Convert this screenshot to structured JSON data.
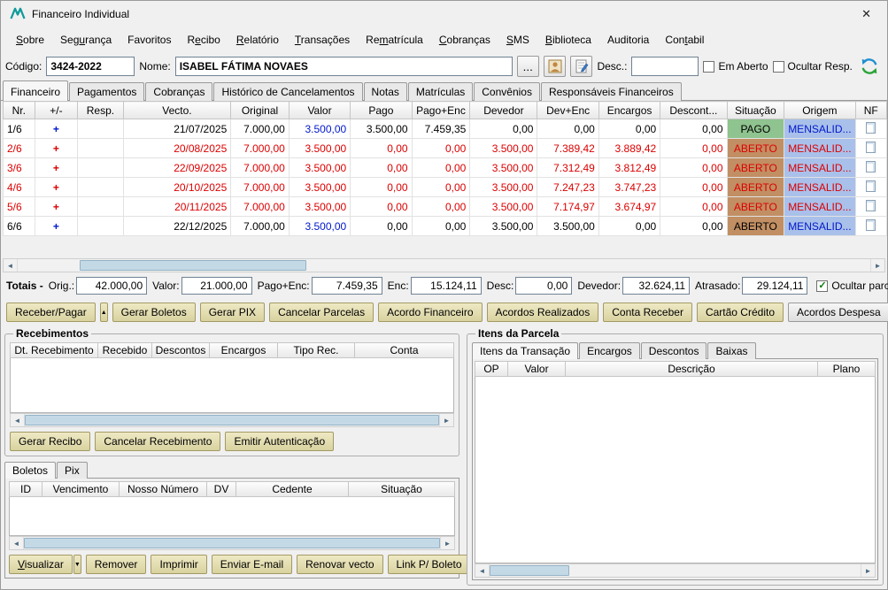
{
  "window": {
    "title": "Financeiro Individual"
  },
  "icons": {
    "close": "✕",
    "check": "✓",
    "up_arrow": "▲",
    "down_arrow": "▼",
    "scroll_left": "◄",
    "scroll_right": "►"
  },
  "colors": {
    "pago_bg": "#8fc38f",
    "aberto_bg": "#c18f63",
    "origem_bg": "#a9c0ea",
    "late_text": "#dc0000",
    "value_text": "#0018cc",
    "button_bg": "#d8d2a0"
  },
  "menu": {
    "items": [
      {
        "label": "Sobre",
        "u": 0
      },
      {
        "label": "Segurança",
        "u": 3
      },
      {
        "label": "Favoritos",
        "u": -1
      },
      {
        "label": "Recibo",
        "u": 1
      },
      {
        "label": "Relatório",
        "u": 0
      },
      {
        "label": "Transações",
        "u": 0
      },
      {
        "label": "Rematrícula",
        "u": 2
      },
      {
        "label": "Cobranças",
        "u": 0
      },
      {
        "label": "SMS",
        "u": 0
      },
      {
        "label": "Biblioteca",
        "u": 0
      },
      {
        "label": "Auditoria",
        "u": -1
      },
      {
        "label": "Contabil",
        "u": 3
      }
    ]
  },
  "header": {
    "codigo_label": "Código:",
    "codigo_value": "3424-2022",
    "nome_label": "Nome:",
    "nome_value": "ISABEL FÁTIMA NOVAES",
    "browse_label": "...",
    "desc_label": "Desc.:",
    "desc_value": "",
    "em_aberto": "Em Aberto",
    "ocultar_resp": "Ocultar Resp."
  },
  "tabs": [
    "Financeiro",
    "Pagamentos",
    "Cobranças",
    "Histórico de Cancelamentos",
    "Notas",
    "Matrículas",
    "Convênios",
    "Responsáveis Financeiros"
  ],
  "grid": {
    "columns": [
      "Nr.",
      "+/-",
      "Resp.",
      "Vecto.",
      "Original",
      "Valor",
      "Pago",
      "Pago+Enc",
      "Devedor",
      "Dev+Enc",
      "Encargos",
      "Descont...",
      "Situação",
      "Origem",
      "NF"
    ],
    "rows": [
      {
        "nr": "1/6",
        "plus": "+",
        "resp": "",
        "vecto": "21/07/2025",
        "original": "7.000,00",
        "valor": "3.500,00",
        "pago": "3.500,00",
        "pago_enc": "7.459,35",
        "devedor": "0,00",
        "dev_enc": "0,00",
        "encargos": "0,00",
        "descont": "0,00",
        "situacao": "PAGO",
        "origem": "MENSALID...",
        "state": "paid"
      },
      {
        "nr": "2/6",
        "plus": "+",
        "resp": "",
        "vecto": "20/08/2025",
        "original": "7.000,00",
        "valor": "3.500,00",
        "pago": "0,00",
        "pago_enc": "0,00",
        "devedor": "3.500,00",
        "dev_enc": "7.389,42",
        "encargos": "3.889,42",
        "descont": "0,00",
        "situacao": "ABERTO",
        "origem": "MENSALID...",
        "state": "late"
      },
      {
        "nr": "3/6",
        "plus": "+",
        "resp": "",
        "vecto": "22/09/2025",
        "original": "7.000,00",
        "valor": "3.500,00",
        "pago": "0,00",
        "pago_enc": "0,00",
        "devedor": "3.500,00",
        "dev_enc": "7.312,49",
        "encargos": "3.812,49",
        "descont": "0,00",
        "situacao": "ABERTO",
        "origem": "MENSALID...",
        "state": "late"
      },
      {
        "nr": "4/6",
        "plus": "+",
        "resp": "",
        "vecto": "20/10/2025",
        "original": "7.000,00",
        "valor": "3.500,00",
        "pago": "0,00",
        "pago_enc": "0,00",
        "devedor": "3.500,00",
        "dev_enc": "7.247,23",
        "encargos": "3.747,23",
        "descont": "0,00",
        "situacao": "ABERTO",
        "origem": "MENSALID...",
        "state": "late"
      },
      {
        "nr": "5/6",
        "plus": "+",
        "resp": "",
        "vecto": "20/11/2025",
        "original": "7.000,00",
        "valor": "3.500,00",
        "pago": "0,00",
        "pago_enc": "0,00",
        "devedor": "3.500,00",
        "dev_enc": "7.174,97",
        "encargos": "3.674,97",
        "descont": "0,00",
        "situacao": "ABERTO",
        "origem": "MENSALID...",
        "state": "late"
      },
      {
        "nr": "6/6",
        "plus": "+",
        "resp": "",
        "vecto": "22/12/2025",
        "original": "7.000,00",
        "valor": "3.500,00",
        "pago": "0,00",
        "pago_enc": "0,00",
        "devedor": "3.500,00",
        "dev_enc": "3.500,00",
        "encargos": "0,00",
        "descont": "0,00",
        "situacao": "ABERTO",
        "origem": "MENSALID...",
        "state": "open"
      }
    ]
  },
  "totals": {
    "prefix": "Totais - ",
    "fields": [
      {
        "label": "Orig.:",
        "value": "42.000,00"
      },
      {
        "label": "Valor:",
        "value": "21.000,00"
      },
      {
        "label": "Pago+Enc:",
        "value": "7.459,35"
      },
      {
        "label": "Enc:",
        "value": "15.124,11"
      },
      {
        "label": "Desc:",
        "value": "0,00"
      },
      {
        "label": "Devedor:",
        "value": "32.624,11"
      },
      {
        "label": "Atrasado:",
        "value": "29.124,11"
      }
    ],
    "ocultar_rc": "Ocultar parcelas RC",
    "ocultar_rc_checked": true
  },
  "actions": [
    {
      "label": "Receber/Pagar",
      "style": "tan",
      "split": "up"
    },
    {
      "label": "Gerar Boletos",
      "style": "tan"
    },
    {
      "label": "Gerar PIX",
      "style": "tan"
    },
    {
      "label": "Cancelar Parcelas",
      "style": "tan"
    },
    {
      "label": "Acordo Financeiro",
      "style": "tan"
    },
    {
      "label": "Acordos Realizados",
      "style": "tan"
    },
    {
      "label": "Conta Receber",
      "style": "tan"
    },
    {
      "label": "Cartão Crédito",
      "style": "tan"
    },
    {
      "label": "Acordos Despesa",
      "style": "gray"
    }
  ],
  "recebimentos": {
    "title": "Recebimentos",
    "columns": [
      "Dt. Recebimento",
      "Recebido",
      "Descontos",
      "Encargos",
      "Tipo Rec.",
      "Conta"
    ],
    "buttons": [
      {
        "label": "Gerar Recibo"
      },
      {
        "label": "Cancelar Recebimento"
      },
      {
        "label": "Emitir Autenticação"
      }
    ]
  },
  "boletos": {
    "tabs": [
      "Boletos",
      "Pix"
    ],
    "columns": [
      "ID",
      "Vencimento",
      "Nosso Número",
      "DV",
      "Cedente",
      "Situação"
    ],
    "buttons": [
      {
        "label": "Visualizar",
        "u": 0,
        "split": "down"
      },
      {
        "label": "Remover"
      },
      {
        "label": "Imprimir"
      },
      {
        "label": "Enviar E-mail"
      },
      {
        "label": "Renovar vecto"
      },
      {
        "label": "Link P/ Boleto"
      }
    ]
  },
  "itens": {
    "title": "Itens da Parcela",
    "tabs": [
      "Itens da Transação",
      "Encargos",
      "Descontos",
      "Baixas"
    ],
    "columns": [
      "OP",
      "Valor",
      "Descrição",
      "Plano"
    ]
  }
}
